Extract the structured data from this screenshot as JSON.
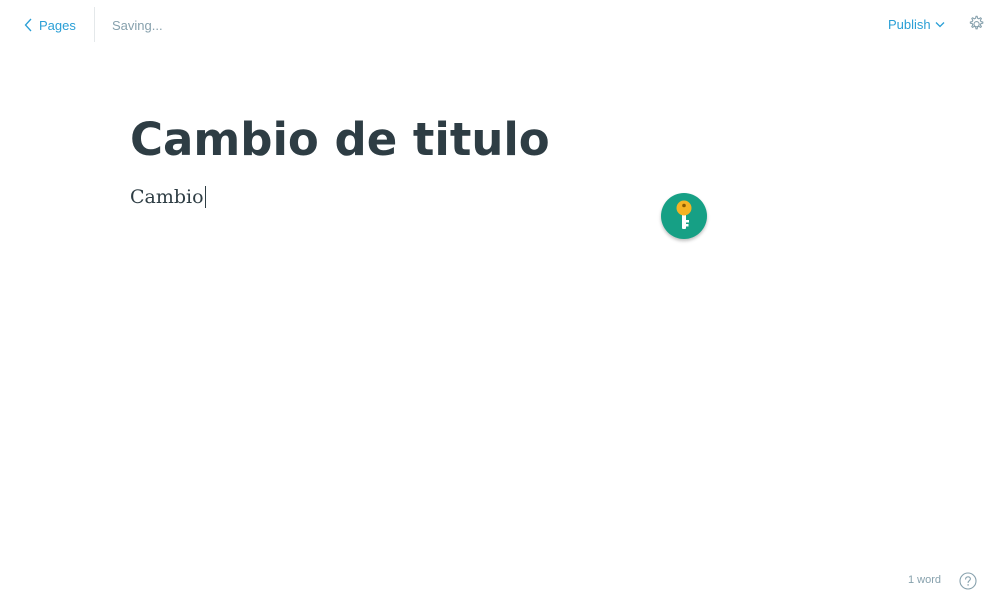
{
  "header": {
    "back_label": "Pages",
    "status": "Saving...",
    "publish_label": "Publish",
    "settings_icon": "gear-icon"
  },
  "editor": {
    "title": "Cambio de titulo",
    "body": "Cambio"
  },
  "extension": {
    "icon": "key-icon",
    "badge_color": "#16a085",
    "key_color": "#f5b324"
  },
  "footer": {
    "word_count": "1 word",
    "help_icon": "help-icon"
  },
  "colors": {
    "accent": "#2a9fd6",
    "muted": "#87a1ad",
    "text": "#2e3d44"
  }
}
